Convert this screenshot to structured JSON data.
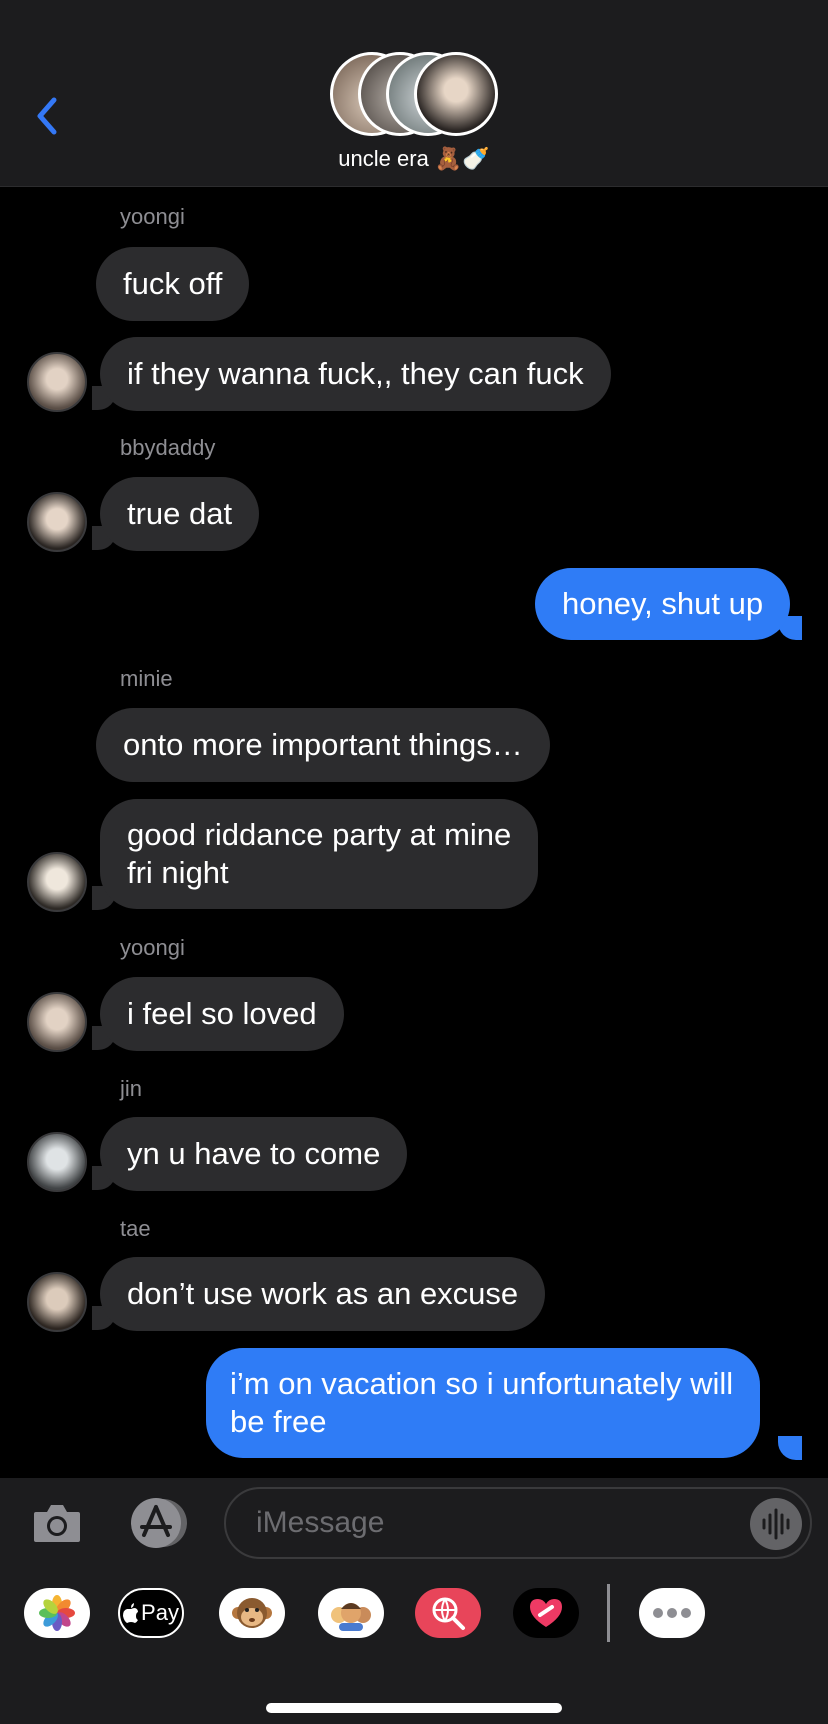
{
  "header": {
    "title": "uncle era 🧸🍼",
    "back_icon": "chevron-left-icon"
  },
  "messages": [
    {
      "sender": "yoongi",
      "text": "fuck off",
      "dir": "in"
    },
    {
      "text": "if they wanna fuck,, they can fuck",
      "dir": "in"
    },
    {
      "sender": "bbydaddy",
      "text": "true dat",
      "dir": "in"
    },
    {
      "text": "honey, shut up",
      "dir": "out"
    },
    {
      "sender": "minie",
      "text": "onto more important things…",
      "dir": "in"
    },
    {
      "text": "good riddance party at mine fri night",
      "dir": "in",
      "lines": [
        "good riddance party at mine",
        "fri night"
      ]
    },
    {
      "sender": "yoongi",
      "text": "i feel so loved",
      "dir": "in"
    },
    {
      "sender": "jin",
      "text": "yn u have to come",
      "dir": "in"
    },
    {
      "sender": "tae",
      "text": "don’t use work as an excuse",
      "dir": "in"
    },
    {
      "text": "i’m on vacation so i unfortunately will be free",
      "dir": "out",
      "lines": [
        "i’m on vacation so i unfortunately will",
        "be free"
      ]
    }
  ],
  "input": {
    "placeholder": "iMessage"
  },
  "apps": {
    "apple_pay_label": "Pay"
  },
  "colors": {
    "outgoing": "#2f7cf6",
    "incoming": "#2c2c2e",
    "background": "#000000",
    "accent": "#3478f6"
  }
}
